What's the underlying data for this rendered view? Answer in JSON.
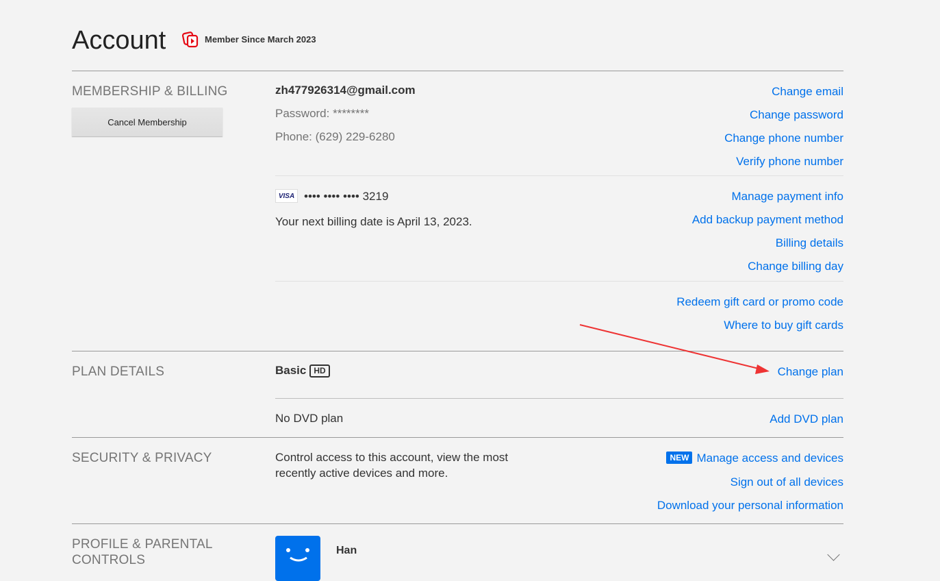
{
  "header": {
    "title": "Account",
    "member_since": "Member Since March 2023"
  },
  "membership": {
    "section_label": "MEMBERSHIP & BILLING",
    "cancel_label": "Cancel Membership",
    "email": "zh477926314@gmail.com",
    "password": "Password: ********",
    "phone": "Phone: (629) 229-6280",
    "links": {
      "change_email": "Change email",
      "change_password": "Change password",
      "change_phone": "Change phone number",
      "verify_phone": "Verify phone number"
    },
    "card_brand": "VISA",
    "card_number": "•••• •••• •••• 3219",
    "billing_date": "Your next billing date is April 13, 2023.",
    "billing_links": {
      "manage_payment": "Manage payment info",
      "add_backup": "Add backup payment method",
      "billing_details": "Billing details",
      "change_billing_day": "Change billing day"
    },
    "gift_links": {
      "redeem": "Redeem gift card or promo code",
      "where_to_buy": "Where to buy gift cards"
    }
  },
  "plan": {
    "section_label": "PLAN DETAILS",
    "plan_name": "Basic",
    "plan_badge": "HD",
    "change_plan": "Change plan",
    "dvd_status": "No DVD plan",
    "add_dvd": "Add DVD plan"
  },
  "security": {
    "section_label": "SECURITY & PRIVACY",
    "description_line1": "Control access to this account, view the most",
    "description_line2": "recently active devices and more.",
    "new_badge": "NEW",
    "manage_access": "Manage access and devices",
    "sign_out_all": "Sign out of all devices",
    "download_info": "Download your personal information"
  },
  "profile": {
    "section_label_line1": "PROFILE & PARENTAL",
    "section_label_line2": "CONTROLS",
    "name": "Han"
  },
  "colors": {
    "link": "#0071eb",
    "background": "#f3f3f3",
    "arrow": "#ee3333",
    "member_icon": "#e50914"
  }
}
